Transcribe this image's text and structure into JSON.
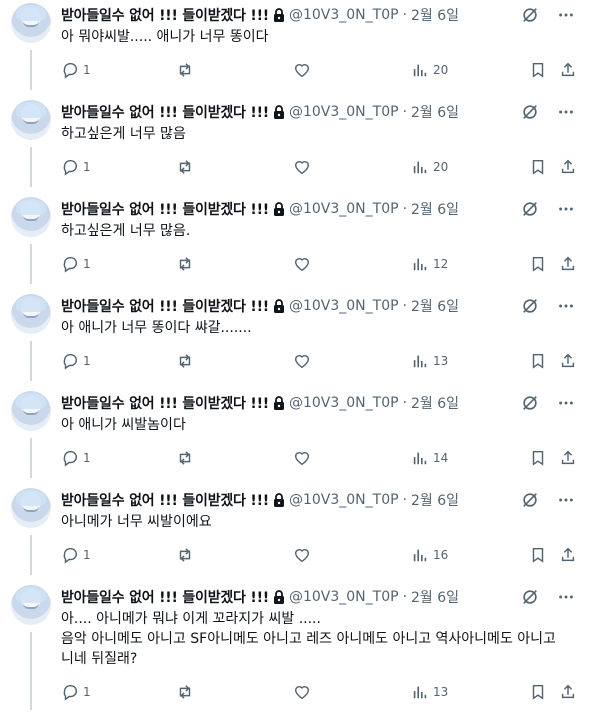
{
  "colors": {
    "text": "#0f1419",
    "muted": "#536471",
    "line": "#cfd9de"
  },
  "tweets": [
    {
      "display_name": "받아들일수 없어 !!! 들이받겠다 !!!",
      "handle": "@10V3_0N_T0P",
      "dot": "·",
      "date": "2월 6일",
      "text": "아 뭐야씨발..... 애니가 너무 똥이다",
      "replies": "1",
      "views": "20"
    },
    {
      "display_name": "받아들일수 없어 !!! 들이받겠다 !!!",
      "handle": "@10V3_0N_T0P",
      "dot": "·",
      "date": "2월 6일",
      "text": "하고싶은게 너무 많음",
      "replies": "1",
      "views": "20"
    },
    {
      "display_name": "받아들일수 없어 !!! 들이받겠다 !!!",
      "handle": "@10V3_0N_T0P",
      "dot": "·",
      "date": "2월 6일",
      "text": "하고싶은게 너무 많음.",
      "replies": "1",
      "views": "12"
    },
    {
      "display_name": "받아들일수 없어 !!! 들이받겠다 !!!",
      "handle": "@10V3_0N_T0P",
      "dot": "·",
      "date": "2월 6일",
      "text": "아 애니가 너무 똥이다 쌰갈.......",
      "replies": "1",
      "views": "13"
    },
    {
      "display_name": "받아들일수 없어 !!! 들이받겠다 !!!",
      "handle": "@10V3_0N_T0P",
      "dot": "·",
      "date": "2월 6일",
      "text": "아 애니가 씨발놈이다",
      "replies": "1",
      "views": "14"
    },
    {
      "display_name": "받아들일수 없어 !!! 들이받겠다 !!!",
      "handle": "@10V3_0N_T0P",
      "dot": "·",
      "date": "2월 6일",
      "text": "아니메가 너무 씨발이에요",
      "replies": "1",
      "views": "16"
    },
    {
      "display_name": "받아들일수 없어 !!! 들이받겠다 !!!",
      "handle": "@10V3_0N_T0P",
      "dot": "·",
      "date": "2월 6일",
      "text": "아.... 아니메가 뭐냐 이게 꼬라지가 씨발 .....\n음악 아니메도 아니고 SF아니메도 아니고 레즈 아니메도 아니고 역사아니메도 아니고\n니네 뒤질래?",
      "replies": "1",
      "views": "13"
    }
  ]
}
